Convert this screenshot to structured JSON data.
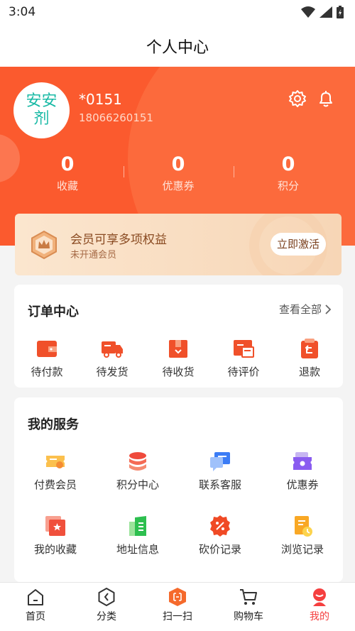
{
  "status_bar": {
    "time": "3:04"
  },
  "nav": {
    "title": "个人中心"
  },
  "profile": {
    "avatar_text_line1": "安安",
    "avatar_text_line2": "剂",
    "name": "*0151",
    "phone": "18066260151"
  },
  "stats": [
    {
      "value": "0",
      "label": "收藏"
    },
    {
      "value": "0",
      "label": "优惠券"
    },
    {
      "value": "0",
      "label": "积分"
    }
  ],
  "vip": {
    "title": "会员可享多项权益",
    "subtitle": "未开通会员",
    "button": "立即激活"
  },
  "orders": {
    "title": "订单中心",
    "view_all": "查看全部",
    "items": [
      {
        "label": "待付款",
        "icon": "wallet-icon"
      },
      {
        "label": "待发货",
        "icon": "truck-icon"
      },
      {
        "label": "待收货",
        "icon": "package-icon"
      },
      {
        "label": "待评价",
        "icon": "review-icon"
      },
      {
        "label": "退款",
        "icon": "refund-icon"
      }
    ]
  },
  "services": {
    "title": "我的服务",
    "items": [
      {
        "label": "付费会员",
        "icon": "vip-ticket-icon"
      },
      {
        "label": "积分中心",
        "icon": "coins-icon"
      },
      {
        "label": "联系客服",
        "icon": "chat-icon"
      },
      {
        "label": "优惠券",
        "icon": "coupon-icon"
      },
      {
        "label": "我的收藏",
        "icon": "star-icon"
      },
      {
        "label": "地址信息",
        "icon": "building-icon"
      },
      {
        "label": "砍价记录",
        "icon": "discount-icon"
      },
      {
        "label": "浏览记录",
        "icon": "history-icon"
      }
    ]
  },
  "tabbar": [
    {
      "label": "首页",
      "icon": "home-icon",
      "active": false
    },
    {
      "label": "分类",
      "icon": "category-icon",
      "active": false
    },
    {
      "label": "扫一扫",
      "icon": "scan-icon",
      "active": false
    },
    {
      "label": "购物车",
      "icon": "cart-icon",
      "active": false
    },
    {
      "label": "我的",
      "icon": "profile-icon",
      "active": true
    }
  ],
  "colors": {
    "brand": "#fb5a2e",
    "active_tab": "#f53f3f",
    "vip_text": "#8a4b22"
  }
}
